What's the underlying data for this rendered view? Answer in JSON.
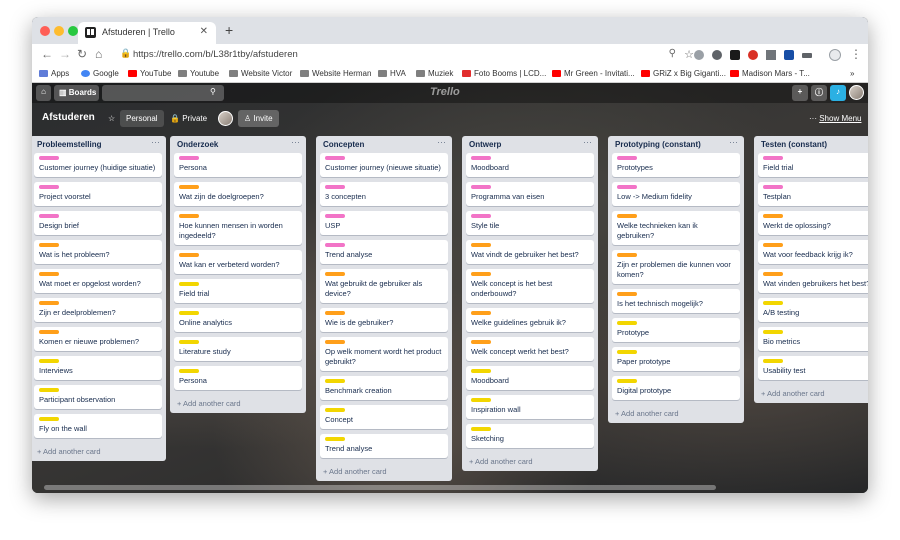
{
  "browser": {
    "tab_title": "Afstuderen | Trello",
    "tab_close": "✕",
    "new_tab": "+",
    "url": "https://trello.com/b/L38r1tby/afstuderen",
    "bookmarks": [
      {
        "label": "Apps",
        "icon": "apps-grid-icon"
      },
      {
        "label": "Google",
        "icon": "google-icon"
      },
      {
        "label": "YouTube",
        "icon": "youtube-icon"
      },
      {
        "label": "Youtube",
        "icon": "folder-icon"
      },
      {
        "label": "Website Victor",
        "icon": "folder-icon"
      },
      {
        "label": "Website Herman",
        "icon": "folder-icon"
      },
      {
        "label": "HVA",
        "icon": "folder-icon"
      },
      {
        "label": "Muziek",
        "icon": "folder-icon"
      },
      {
        "label": "Foto Booms | LCD...",
        "icon": "fb-icon"
      },
      {
        "label": "Mr Green - Invitati...",
        "icon": "youtube-icon"
      },
      {
        "label": "GRiZ x Big Giganti...",
        "icon": "youtube-icon"
      },
      {
        "label": "Madison Mars - T...",
        "icon": "youtube-icon"
      }
    ],
    "more_bookmarks": "»"
  },
  "trello": {
    "boards_label": "Boards",
    "logo": "Trello",
    "board_name": "Afstuderen",
    "team_label": "Personal",
    "visibility_label": "Private",
    "invite_label": "Invite",
    "show_menu_label": "Show Menu",
    "add_card_label": "+ Add another card",
    "colors": {
      "pink": "#f274c7",
      "orange": "#ff9f1a",
      "yellow": "#f2d600"
    },
    "lists": [
      {
        "title": "Probleemstelling",
        "cards": [
          {
            "label": "pink",
            "text": "Customer journey (huidige situatie)"
          },
          {
            "label": "pink",
            "text": "Project voorstel"
          },
          {
            "label": "pink",
            "text": "Design brief"
          },
          {
            "label": "orange",
            "text": "Wat is het probleem?"
          },
          {
            "label": "orange",
            "text": "Wat moet er opgelost worden?"
          },
          {
            "label": "orange",
            "text": "Zijn er deelproblemen?"
          },
          {
            "label": "orange",
            "text": "Komen er nieuwe problemen?"
          },
          {
            "label": "yellow",
            "text": "Interviews"
          },
          {
            "label": "yellow",
            "text": "Participant observation"
          },
          {
            "label": "yellow",
            "text": "Fly on the wall"
          }
        ]
      },
      {
        "title": "Onderzoek",
        "cards": [
          {
            "label": "pink",
            "text": "Persona"
          },
          {
            "label": "orange",
            "text": "Wat zijn de doelgroepen?"
          },
          {
            "label": "orange",
            "text": "Hoe kunnen mensen in worden ingedeeld?"
          },
          {
            "label": "orange",
            "text": "Wat kan er verbeterd worden?"
          },
          {
            "label": "yellow",
            "text": "Field trial"
          },
          {
            "label": "yellow",
            "text": "Online analytics"
          },
          {
            "label": "yellow",
            "text": "Literature study"
          },
          {
            "label": "yellow",
            "text": "Persona"
          }
        ]
      },
      {
        "title": "Concepten",
        "cards": [
          {
            "label": "pink",
            "text": "Customer journey (nieuwe situatie)"
          },
          {
            "label": "pink",
            "text": "3 concepten"
          },
          {
            "label": "pink",
            "text": "USP"
          },
          {
            "label": "pink",
            "text": "Trend analyse"
          },
          {
            "label": "orange",
            "text": "Wat gebruikt de gebruiker als device?"
          },
          {
            "label": "orange",
            "text": "Wie is de gebruiker?"
          },
          {
            "label": "orange",
            "text": "Op welk moment wordt het product gebruikt?"
          },
          {
            "label": "yellow",
            "text": "Benchmark creation"
          },
          {
            "label": "yellow",
            "text": "Concept"
          },
          {
            "label": "yellow",
            "text": "Trend analyse"
          }
        ]
      },
      {
        "title": "Ontwerp",
        "cards": [
          {
            "label": "pink",
            "text": "Moodboard"
          },
          {
            "label": "pink",
            "text": "Programma van eisen"
          },
          {
            "label": "pink",
            "text": "Style tile"
          },
          {
            "label": "orange",
            "text": "Wat vindt de gebruiker het best?"
          },
          {
            "label": "orange",
            "text": "Welk concept is het best onderbouwd?"
          },
          {
            "label": "orange",
            "text": "Welke guidelines gebruik ik?"
          },
          {
            "label": "orange",
            "text": "Welk concept werkt het best?"
          },
          {
            "label": "yellow",
            "text": "Moodboard"
          },
          {
            "label": "yellow",
            "text": "Inspiration wall"
          },
          {
            "label": "yellow",
            "text": "Sketching"
          }
        ]
      },
      {
        "title": "Prototyping (constant)",
        "cards": [
          {
            "label": "pink",
            "text": "Prototypes"
          },
          {
            "label": "pink",
            "text": "Low -> Medium fidelity"
          },
          {
            "label": "orange",
            "text": "Welke technieken kan ik gebruiken?"
          },
          {
            "label": "orange",
            "text": "Zijn er problemen die kunnen voor komen?"
          },
          {
            "label": "orange",
            "text": "Is het technisch mogelijk?"
          },
          {
            "label": "yellow",
            "text": "Prototype"
          },
          {
            "label": "yellow",
            "text": "Paper prototype"
          },
          {
            "label": "yellow",
            "text": "Digital prototype"
          }
        ]
      },
      {
        "title": "Testen (constant)",
        "cards": [
          {
            "label": "pink",
            "text": "Field trial"
          },
          {
            "label": "pink",
            "text": "Testplan"
          },
          {
            "label": "orange",
            "text": "Werkt de oplossing?"
          },
          {
            "label": "orange",
            "text": "Wat voor feedback krijg ik?"
          },
          {
            "label": "orange",
            "text": "Wat vinden gebruikers het best?"
          },
          {
            "label": "yellow",
            "text": "A/B testing"
          },
          {
            "label": "yellow",
            "text": "Bio metrics"
          },
          {
            "label": "yellow",
            "text": "Usability test"
          }
        ]
      }
    ]
  }
}
